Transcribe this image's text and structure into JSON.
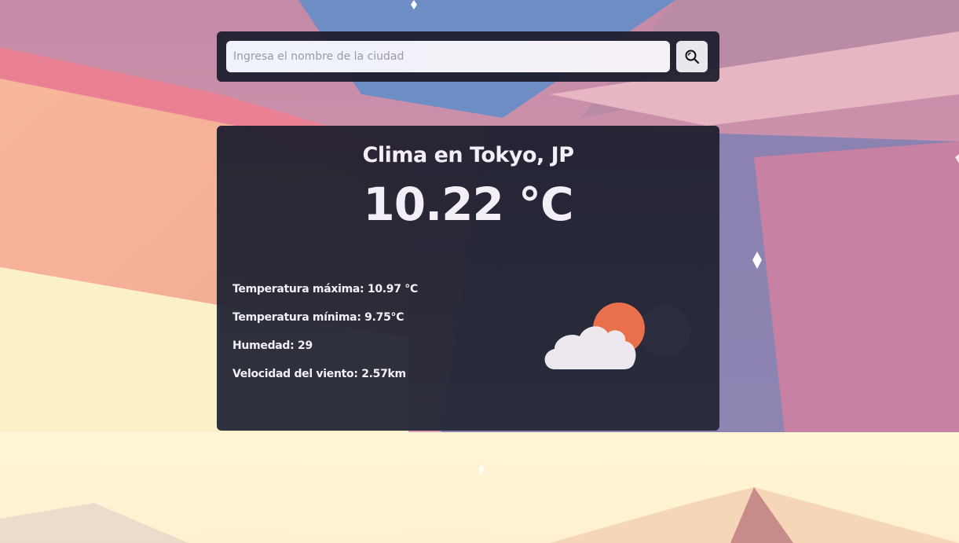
{
  "search": {
    "placeholder": "Ingresa el nombre de la ciudad",
    "icon": "search-icon"
  },
  "weather": {
    "title": "Clima en Tokyo, JP",
    "temperature": "10.22 °C",
    "details": [
      "Temperatura máxima: 10.97 °C",
      "Temperatura mínima: 9.75°C",
      "Humedad: 29",
      "Velocidad del viento: 2.57km"
    ],
    "icon": "partly-cloudy-icon"
  },
  "colors": {
    "panel": "#1b1c2c",
    "text": "#f4eef6",
    "sun": "#e8704a",
    "cloud": "#ece8ee"
  }
}
